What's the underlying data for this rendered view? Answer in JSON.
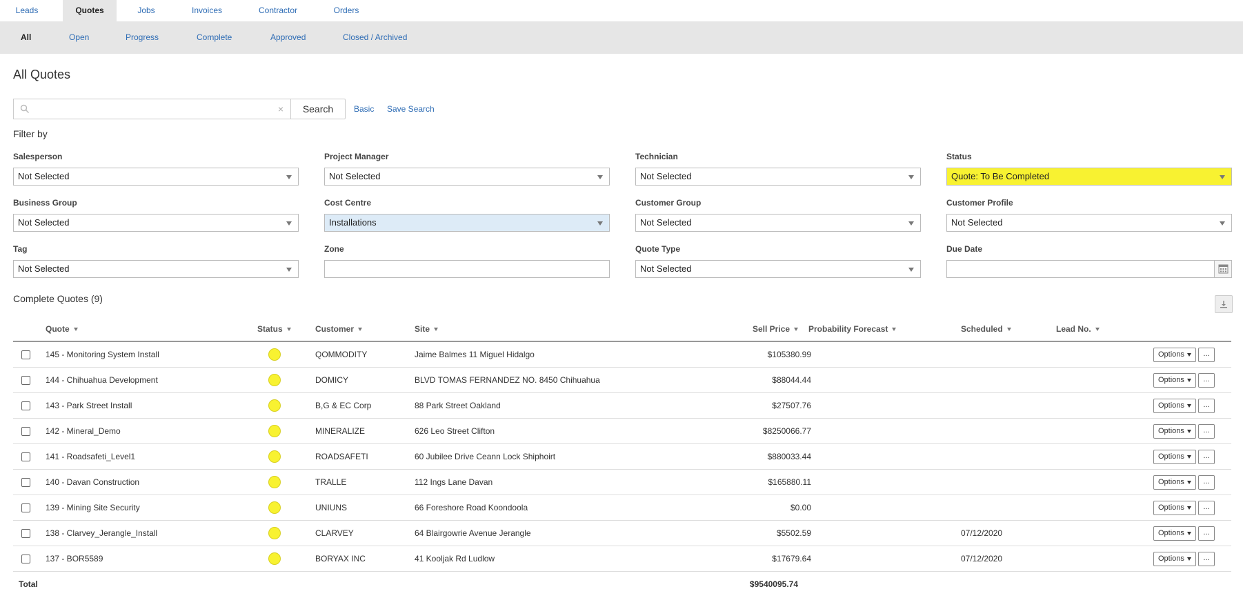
{
  "top_tabs": [
    "Leads",
    "Quotes",
    "Jobs",
    "Invoices",
    "Contractor",
    "Orders"
  ],
  "active_top_tab": "Quotes",
  "sub_tabs": [
    "All",
    "Open",
    "Progress",
    "Complete",
    "Approved",
    "Closed / Archived"
  ],
  "active_sub_tab": "All",
  "page_title": "All Quotes",
  "search": {
    "value": "",
    "placeholder": "",
    "clear_icon": "×",
    "button_label": "Search"
  },
  "links": {
    "basic": "Basic",
    "save_search": "Save Search"
  },
  "filter_by_label": "Filter by",
  "filters": [
    {
      "label": "Salesperson",
      "value": "Not Selected",
      "type": "select"
    },
    {
      "label": "Project Manager",
      "value": "Not Selected",
      "type": "select"
    },
    {
      "label": "Technician",
      "value": "Not Selected",
      "type": "select"
    },
    {
      "label": "Status",
      "value": "Quote: To Be Completed",
      "type": "select",
      "highlight": "#f8f231"
    },
    {
      "label": "Business Group",
      "value": "Not Selected",
      "type": "select"
    },
    {
      "label": "Cost Centre",
      "value": "Installations",
      "type": "select",
      "highlight": "#ddebf7"
    },
    {
      "label": "Customer Group",
      "value": "Not Selected",
      "type": "select"
    },
    {
      "label": "Customer Profile",
      "value": "Not Selected",
      "type": "select"
    },
    {
      "label": "Tag",
      "value": "Not Selected",
      "type": "select"
    },
    {
      "label": "Zone",
      "value": "",
      "type": "text"
    },
    {
      "label": "Quote Type",
      "value": "Not Selected",
      "type": "select"
    },
    {
      "label": "Due Date",
      "value": "",
      "type": "date"
    }
  ],
  "table": {
    "title": "Complete Quotes (9)",
    "columns": [
      "Quote",
      "Status",
      "Customer",
      "Site",
      "Sell Price",
      "Probability Forecast",
      "Scheduled",
      "Lead No."
    ],
    "rows": [
      {
        "quote": "145 - Monitoring System Install",
        "customer": "QOMMODITY",
        "site": "Jaime Balmes 11 Miguel Hidalgo",
        "sell_price": "$105380.99",
        "probability": "",
        "scheduled": "",
        "lead_no": ""
      },
      {
        "quote": "144 - Chihuahua Development",
        "customer": "DOMICY",
        "site": "BLVD TOMAS FERNANDEZ NO. 8450 Chihuahua",
        "sell_price": "$88044.44",
        "probability": "",
        "scheduled": "",
        "lead_no": ""
      },
      {
        "quote": "143 - Park Street Install",
        "customer": "B,G & EC Corp",
        "site": "88 Park Street Oakland",
        "sell_price": "$27507.76",
        "probability": "",
        "scheduled": "",
        "lead_no": ""
      },
      {
        "quote": "142 - Mineral_Demo",
        "customer": "MINERALIZE",
        "site": "626 Leo Street Clifton",
        "sell_price": "$8250066.77",
        "probability": "",
        "scheduled": "",
        "lead_no": ""
      },
      {
        "quote": "141 - Roadsafeti_Level1",
        "customer": "ROADSAFETI",
        "site": "60 Jubilee Drive Ceann Lock Shiphoirt",
        "sell_price": "$880033.44",
        "probability": "",
        "scheduled": "",
        "lead_no": ""
      },
      {
        "quote": "140 - Davan Construction",
        "customer": "TRALLE",
        "site": "112 Ings Lane Davan",
        "sell_price": "$165880.11",
        "probability": "",
        "scheduled": "",
        "lead_no": ""
      },
      {
        "quote": "139 - Mining Site Security",
        "customer": "UNIUNS",
        "site": "66 Foreshore Road Koondoola",
        "sell_price": "$0.00",
        "probability": "",
        "scheduled": "",
        "lead_no": ""
      },
      {
        "quote": "138 - Clarvey_Jerangle_Install",
        "customer": "CLARVEY",
        "site": "64 Blairgowrie Avenue Jerangle",
        "sell_price": "$5502.59",
        "probability": "",
        "scheduled": "07/12/2020",
        "lead_no": ""
      },
      {
        "quote": "137 - BOR5589",
        "customer": "BORYAX INC",
        "site": "41 Kooljak Rd Ludlow",
        "sell_price": "$17679.64",
        "probability": "",
        "scheduled": "07/12/2020",
        "lead_no": ""
      }
    ],
    "status_color": "#f8f231",
    "options_label": "Options",
    "more_label": "...",
    "total_label": "Total",
    "total_value": "$9540095.74"
  },
  "colors": {
    "link": "#2f6db5",
    "tab_bar": "#e6e6e6",
    "status_highlight": "#f8f231",
    "cost_centre_highlight": "#ddebf7"
  }
}
